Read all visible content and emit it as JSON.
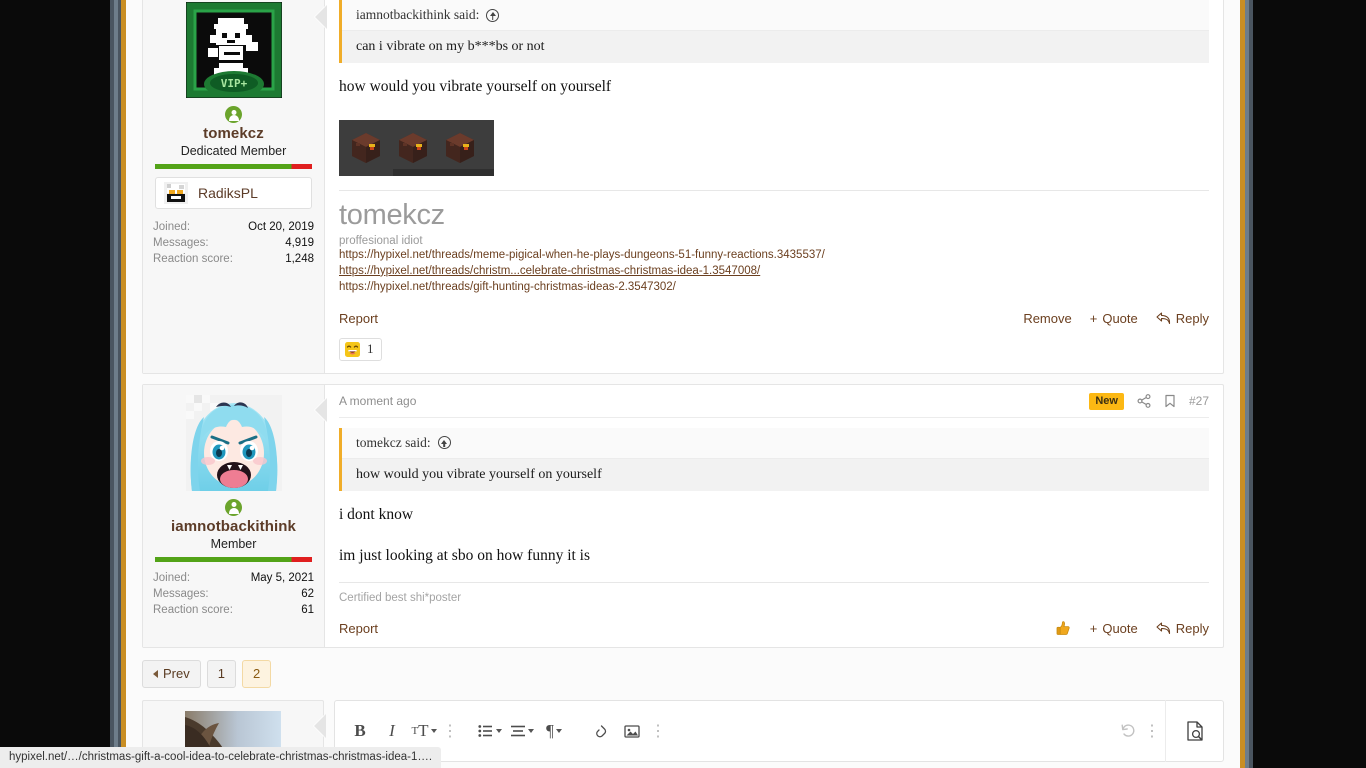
{
  "browser": {
    "status_url": "hypixel.net/…/christmas-gift-a-cool-idea-to-celebrate-christmas-christmas-idea-1…."
  },
  "chrome": {
    "left_stripes": [
      "#0a0a0a",
      "#4a5560",
      "#6e7d8a",
      "#c98e24"
    ],
    "right_stripes": [
      "#c98e24",
      "#6e7d8a",
      "#4a5560",
      "#0a0a0a"
    ],
    "page_bg": "#fbfbfb"
  },
  "posts": [
    {
      "author": {
        "username": "tomekcz",
        "title": "Dedicated Member",
        "rank_badge": "VIP+",
        "online_status_icon": "online-user-icon",
        "ribbon_label": "RadiksPL",
        "stats": [
          {
            "label": "Joined:",
            "value": "Oct 20, 2019"
          },
          {
            "label": "Messages:",
            "value": "4,919"
          },
          {
            "label": "Reaction score:",
            "value": "1,248"
          }
        ]
      },
      "quote": {
        "attribution": "iamnotbackithink said:",
        "jump_icon": "jump-to-quote-icon",
        "text": "can i vibrate on my b***bs or not"
      },
      "body": [
        "how would you vibrate yourself on yourself"
      ],
      "attachment": {
        "alt": "netherrack-blocks-image",
        "count": 3
      },
      "signature": {
        "name": "tomekcz",
        "tagline": "proffesional idiot",
        "links": [
          {
            "text": "https://hypixel.net/threads/meme-pigical-when-he-plays-dungeons-51-funny-reactions.3435537/",
            "underline": false
          },
          {
            "text": "https://hypixel.net/threads/christm...celebrate-christmas-christmas-idea-1.3547008/",
            "underline": true
          },
          {
            "text": "https://hypixel.net/threads/gift-hunting-christmas-ideas-2.3547302/",
            "underline": false
          }
        ]
      },
      "actions": {
        "report": "Report",
        "remove": "Remove",
        "quote": "Quote",
        "quote_plus": "+",
        "reply": "Reply",
        "reply_icon": "reply-arrow-icon"
      },
      "reactions": [
        {
          "emoji_name": "grinning-squinting-face-emoji",
          "count": "1"
        }
      ]
    },
    {
      "author": {
        "username": "iamnotbackithink",
        "title": "Member",
        "online_status_icon": "online-user-icon",
        "stats": [
          {
            "label": "Joined:",
            "value": "May 5, 2021"
          },
          {
            "label": "Messages:",
            "value": "62"
          },
          {
            "label": "Reaction score:",
            "value": "61"
          }
        ]
      },
      "header": {
        "date": "A moment ago",
        "new_badge": "New",
        "share_icon": "share-icon",
        "bookmark_icon": "bookmark-icon",
        "post_number": "#27"
      },
      "quote": {
        "attribution": "tomekcz said:",
        "jump_icon": "jump-to-quote-icon",
        "text": "how would you vibrate yourself on yourself"
      },
      "body": [
        "i dont know",
        "im just looking at sbo on how funny it is"
      ],
      "signature": {
        "note": "Certified best shi*poster"
      },
      "actions": {
        "report": "Report",
        "like_icon": "thumbs-up-emoji",
        "quote": "Quote",
        "quote_plus": "+",
        "reply": "Reply",
        "reply_icon": "reply-arrow-icon"
      }
    }
  ],
  "pagination": {
    "prev_label": "Prev",
    "prev_icon": "chevron-left-icon",
    "pages": [
      {
        "label": "1",
        "active": false
      },
      {
        "label": "2",
        "active": true
      }
    ]
  },
  "editor": {
    "tools": [
      {
        "name": "bold-button",
        "glyph": "B"
      },
      {
        "name": "italic-button",
        "glyph": "I"
      },
      {
        "name": "font-size-button",
        "glyph": "TT"
      },
      {
        "name": "more-text-options-button",
        "glyph": "⋮"
      },
      {
        "name": "list-button",
        "glyph": "list"
      },
      {
        "name": "align-button",
        "glyph": "align"
      },
      {
        "name": "paragraph-format-button",
        "glyph": "¶"
      },
      {
        "name": "insert-link-button",
        "glyph": "link"
      },
      {
        "name": "insert-image-button",
        "glyph": "image"
      },
      {
        "name": "more-insert-options-button",
        "glyph": "⋮"
      }
    ],
    "undo_icon": "undo-icon",
    "overflow_icon": "vertical-dots-icon",
    "preview_icon": "preview-document-icon"
  }
}
